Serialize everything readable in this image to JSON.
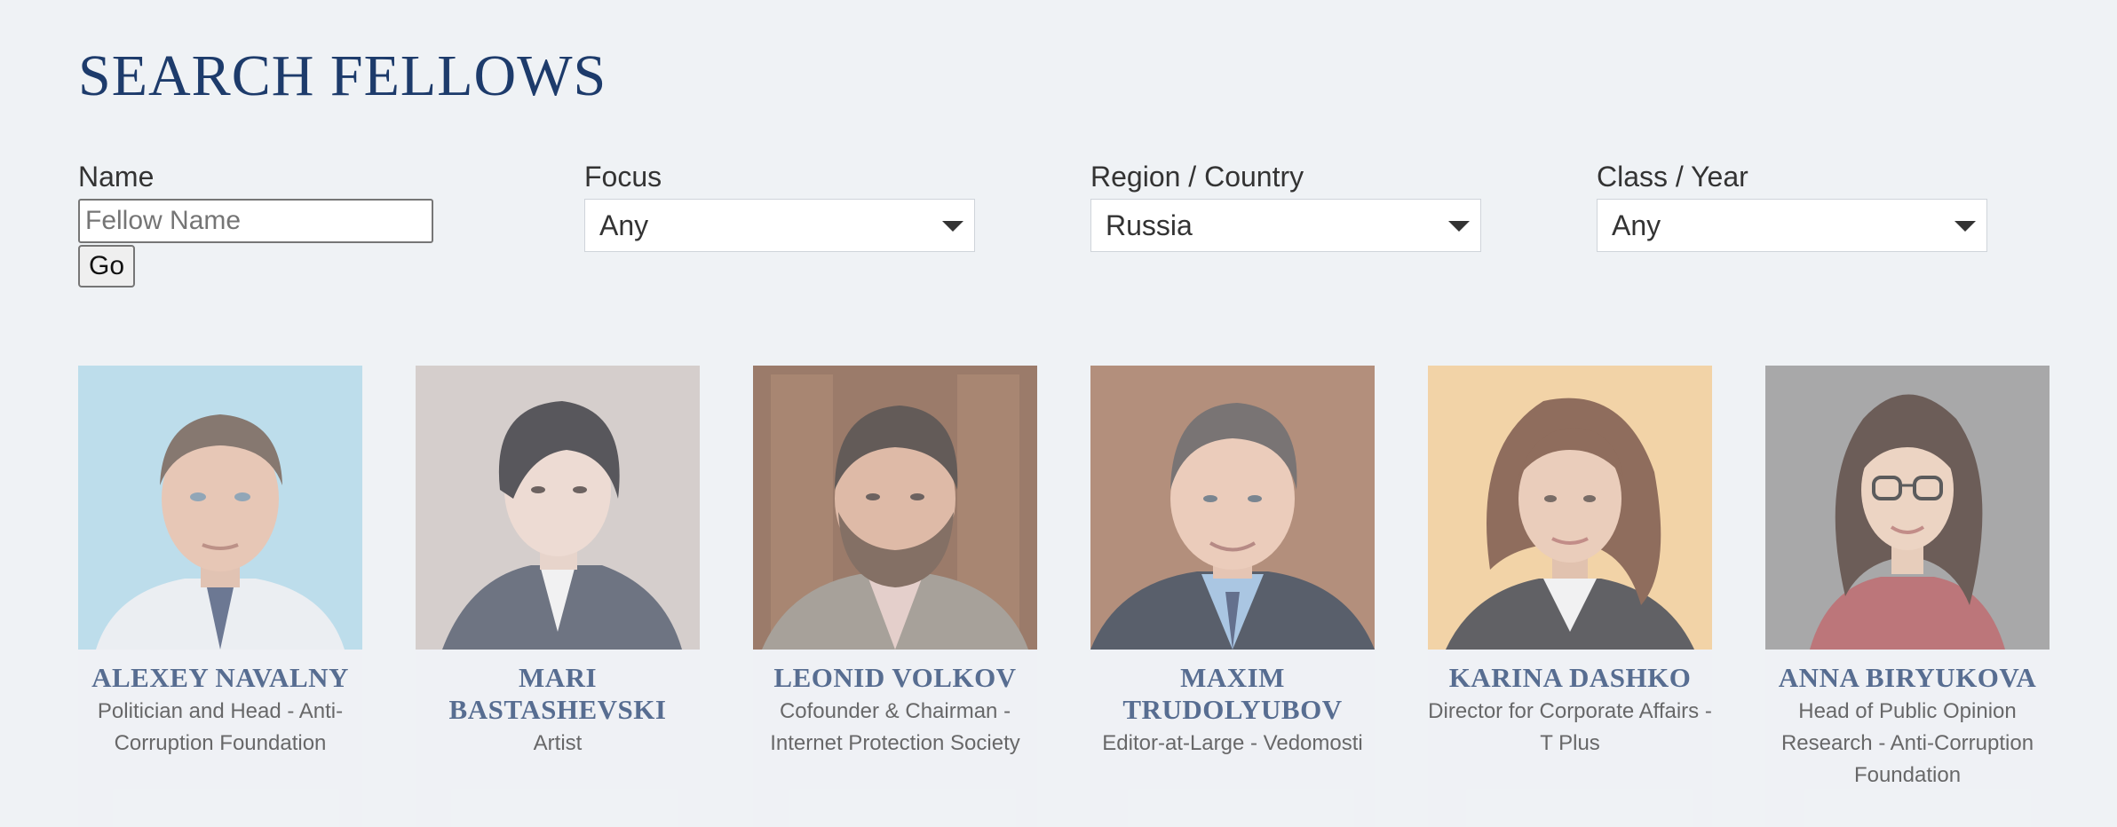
{
  "page": {
    "title": "SEARCH FELLOWS"
  },
  "filters": {
    "name": {
      "label": "Name",
      "placeholder": "Fellow Name",
      "value": "",
      "button": "Go"
    },
    "focus": {
      "label": "Focus",
      "selected": "Any"
    },
    "region": {
      "label": "Region / Country",
      "selected": "Russia"
    },
    "class_year": {
      "label": "Class / Year",
      "selected": "Any"
    }
  },
  "fellows": [
    {
      "name": "ALEXEY NAVALNY",
      "title": "Politician and Head - Anti-Corruption Foundation"
    },
    {
      "name": "MARI BASTASHEVSKI",
      "title": "Artist"
    },
    {
      "name": "LEONID VOLKOV",
      "title": "Cofounder & Chairman - Internet Protection Society"
    },
    {
      "name": "MAXIM TRUDOLYUBOV",
      "title": "Editor-at-Large - Vedomosti"
    },
    {
      "name": "KARINA DASHKO",
      "title": "Director for Corporate Affairs - T Plus"
    },
    {
      "name": "ANNA BIRYUKOVA",
      "title": "Head of Public Opinion Research - Anti-Corruption Foundation"
    }
  ]
}
